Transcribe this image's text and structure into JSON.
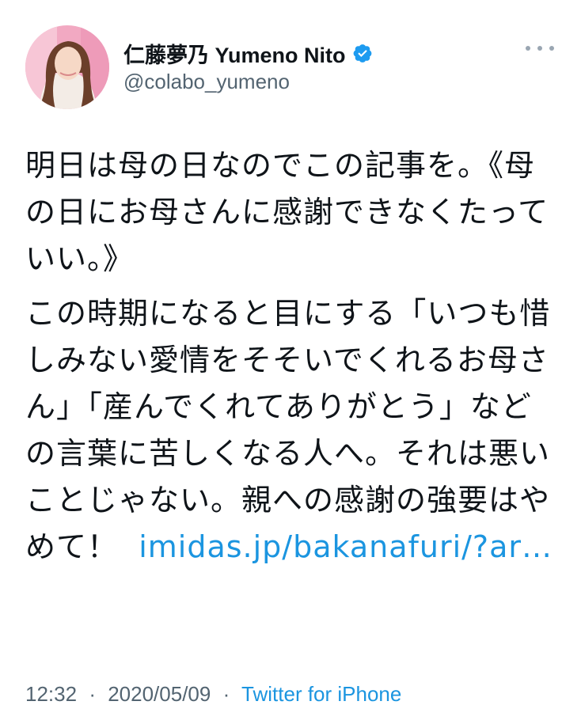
{
  "author": {
    "display_name": "仁藤夢乃  Yumeno Nito",
    "handle": "@colabo_yumeno",
    "verified": true,
    "avatar_icon": "profile-photo",
    "more_icon": "ellipsis-icon"
  },
  "tweet": {
    "paragraph1": "明日は母の日なのでこの記事を。《母の日にお母さんに感謝できなくたっていい。》",
    "paragraph2_text": "この時期になると目にする「いつも惜しみない愛情をそそいでくれるお母さん」「産んでくれてありがとう」などの言葉に苦しくなる人へ。それは悪いことじゃない。親への感謝の強要はやめて！",
    "link_text": "imidas.jp/bakanafuri/?ar…"
  },
  "meta": {
    "time": "12:32",
    "date": "2020/05/09",
    "separator": "·",
    "source": "Twitter for iPhone"
  },
  "colors": {
    "link": "#1b95e0",
    "verified_badge": "#1d9bf0",
    "secondary_text": "#536471"
  }
}
